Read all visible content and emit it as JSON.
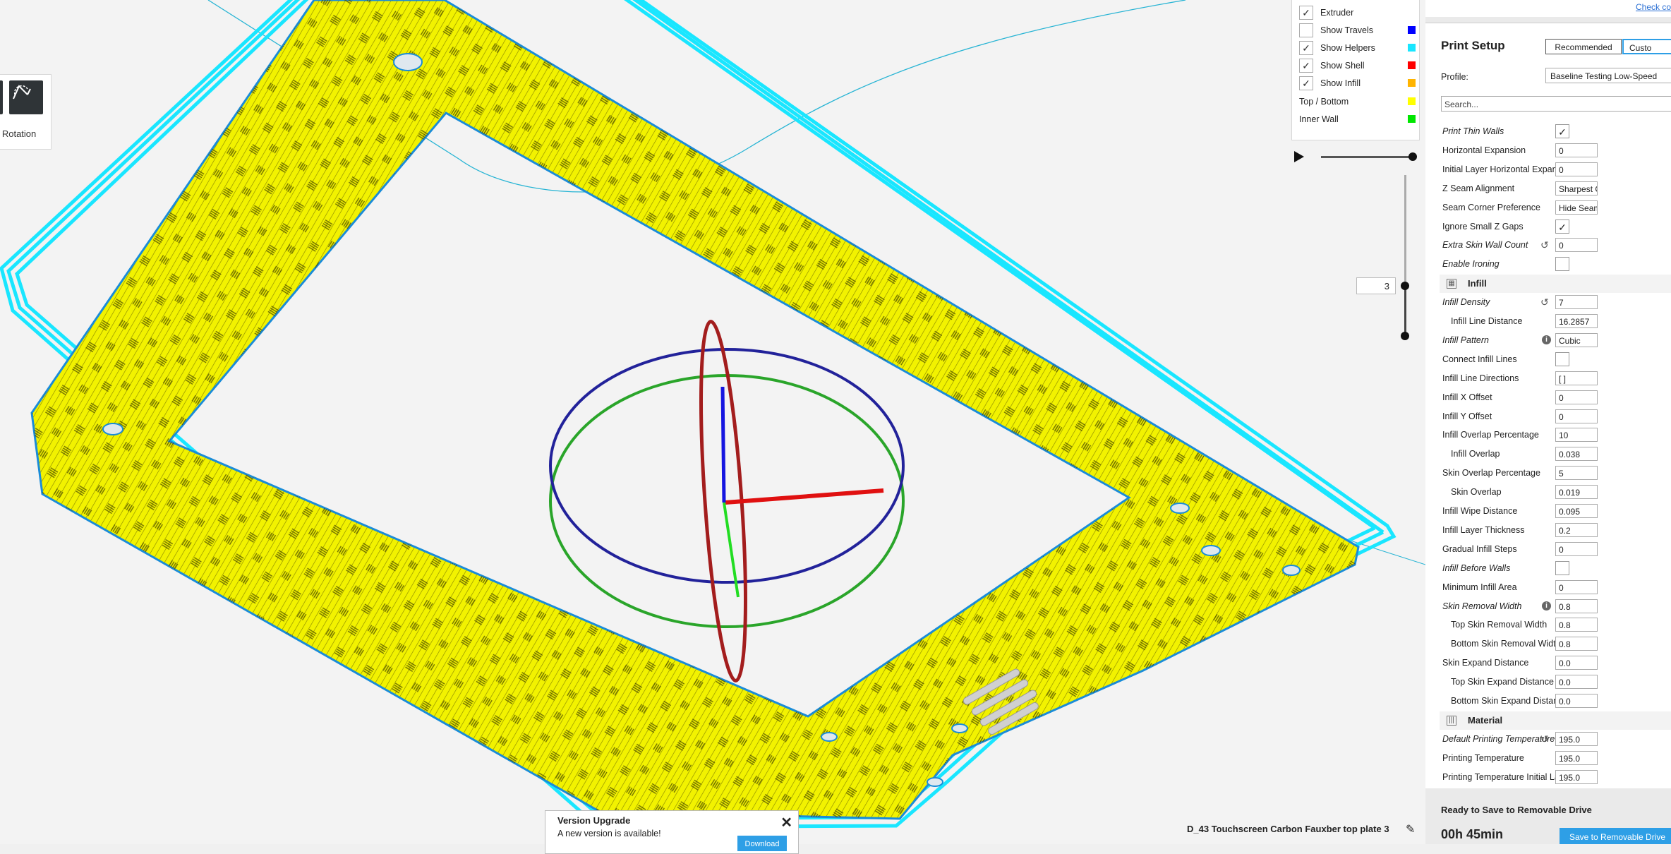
{
  "viewport": {
    "rotation_tool": {
      "label": "p Rotation"
    },
    "legend": {
      "items": [
        {
          "label": "Extruder",
          "checked": true,
          "color": null
        },
        {
          "label": "Show Travels",
          "checked": false,
          "color": "#0000ff"
        },
        {
          "label": "Show Helpers",
          "checked": true,
          "color": "#19e6ff"
        },
        {
          "label": "Show Shell",
          "checked": true,
          "color": "#ff0000"
        },
        {
          "label": "Show Infill",
          "checked": true,
          "color": "#ffb400"
        },
        {
          "label": "Top / Bottom",
          "checked": null,
          "color": "#ffff00"
        },
        {
          "label": "Inner Wall",
          "checked": null,
          "color": "#00e600"
        }
      ]
    },
    "layer_number": "3",
    "version_popup": {
      "title": "Version Upgrade",
      "message": "A new version is available!",
      "close_glyph": "✕",
      "download_label": "Download"
    },
    "job_name": "D_43 Touchscreen Carbon Fauxber top plate 3"
  },
  "print_setup": {
    "check_link": "Check co",
    "title": "Print Setup",
    "tabs": {
      "recommended": "Recommended",
      "custom": "Custo"
    },
    "profile_label": "Profile:",
    "profile_value": "Baseline Testing Low-Speed",
    "search_placeholder": "Search...",
    "settings": [
      {
        "kind": "check",
        "name": "Print Thin Walls",
        "italic": true,
        "checked": true
      },
      {
        "kind": "value",
        "name": "Horizontal Expansion",
        "value": "0"
      },
      {
        "kind": "value",
        "name": "Initial Layer Horizontal Expansion",
        "value": "0"
      },
      {
        "kind": "value",
        "name": "Z Seam Alignment",
        "value": "Sharpest C"
      },
      {
        "kind": "value",
        "name": "Seam Corner Preference",
        "value": "Hide Seam"
      },
      {
        "kind": "check",
        "name": "Ignore Small Z Gaps",
        "checked": true
      },
      {
        "kind": "value",
        "name": "Extra Skin Wall Count",
        "italic": true,
        "reset": true,
        "value": "0"
      },
      {
        "kind": "check",
        "name": "Enable Ironing",
        "italic": true,
        "checked": false
      },
      {
        "kind": "category",
        "name": "Infill",
        "icon": "infill-icon"
      },
      {
        "kind": "value",
        "name": "Infill Density",
        "italic": true,
        "reset": true,
        "value": "7"
      },
      {
        "kind": "value",
        "name": "Infill Line Distance",
        "indent": true,
        "value": "16.2857"
      },
      {
        "kind": "value",
        "name": "Infill Pattern",
        "italic": true,
        "info": true,
        "value": "Cubic"
      },
      {
        "kind": "check",
        "name": "Connect Infill Lines",
        "checked": false
      },
      {
        "kind": "value",
        "name": "Infill Line Directions",
        "value": "[ ]"
      },
      {
        "kind": "value",
        "name": "Infill X Offset",
        "value": "0"
      },
      {
        "kind": "value",
        "name": "Infill Y Offset",
        "value": "0"
      },
      {
        "kind": "value",
        "name": "Infill Overlap Percentage",
        "value": "10"
      },
      {
        "kind": "value",
        "name": "Infill Overlap",
        "indent": true,
        "value": "0.038"
      },
      {
        "kind": "value",
        "name": "Skin Overlap Percentage",
        "value": "5"
      },
      {
        "kind": "value",
        "name": "Skin Overlap",
        "indent": true,
        "value": "0.019"
      },
      {
        "kind": "value",
        "name": "Infill Wipe Distance",
        "value": "0.095"
      },
      {
        "kind": "value",
        "name": "Infill Layer Thickness",
        "value": "0.2"
      },
      {
        "kind": "value",
        "name": "Gradual Infill Steps",
        "value": "0"
      },
      {
        "kind": "check",
        "name": "Infill Before Walls",
        "italic": true,
        "checked": false
      },
      {
        "kind": "value",
        "name": "Minimum Infill Area",
        "value": "0"
      },
      {
        "kind": "value",
        "name": "Skin Removal Width",
        "italic": true,
        "info": true,
        "value": "0.8"
      },
      {
        "kind": "value",
        "name": "Top Skin Removal Width",
        "indent": true,
        "value": "0.8"
      },
      {
        "kind": "value",
        "name": "Bottom Skin Removal Width",
        "indent": true,
        "value": "0.8"
      },
      {
        "kind": "value",
        "name": "Skin Expand Distance",
        "value": "0.0"
      },
      {
        "kind": "value",
        "name": "Top Skin Expand Distance",
        "indent": true,
        "value": "0.0"
      },
      {
        "kind": "value",
        "name": "Bottom Skin Expand Distance",
        "indent": true,
        "value": "0.0"
      },
      {
        "kind": "category",
        "name": "Material",
        "icon": "material-icon"
      },
      {
        "kind": "value",
        "name": "Default Printing Temperature",
        "italic": true,
        "reset": true,
        "value": "195.0"
      },
      {
        "kind": "value",
        "name": "Printing Temperature",
        "value": "195.0"
      },
      {
        "kind": "value",
        "name": "Printing Temperature Initial Layer",
        "value": "195.0"
      }
    ],
    "ready_text": "Ready to Save to Removable Drive",
    "print_time": "00h 45min",
    "save_button": "Save to Removable Drive"
  },
  "colors": {
    "shell_cyan": "#19e6ff",
    "wall_blue": "#1a8cd8",
    "skin_yellow": "#f2f200",
    "accent": "#2e9fe6"
  }
}
